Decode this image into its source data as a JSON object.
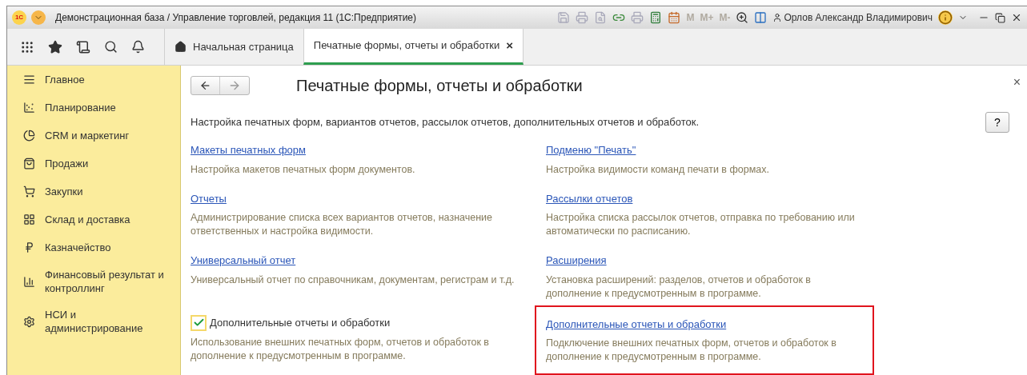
{
  "window": {
    "title": "Демонстрационная база / Управление торговлей, редакция 11  (1С:Предприятие)",
    "logo": "1C",
    "memory_buttons": [
      "M",
      "M+",
      "M-"
    ],
    "user": "Орлов Александр Владимирович"
  },
  "tabs": [
    {
      "label": "Начальная страница",
      "selected": false
    },
    {
      "label": "Печатные формы, отчеты и обработки",
      "selected": true,
      "close": "×"
    }
  ],
  "sidebar": {
    "items": [
      {
        "label": "Главное"
      },
      {
        "label": "Планирование"
      },
      {
        "label": "CRM и маркетинг"
      },
      {
        "label": "Продажи"
      },
      {
        "label": "Закупки"
      },
      {
        "label": "Склад и доставка"
      },
      {
        "label": "Казначейство"
      },
      {
        "label": "Финансовый результат и контроллинг"
      },
      {
        "label": "НСИ и администрирование"
      }
    ]
  },
  "page": {
    "title": "Печатные формы, отчеты и обработки",
    "close": "×",
    "help": "?",
    "description": "Настройка печатных форм, вариантов отчетов, рассылок отчетов, дополнительных отчетов и обработок.",
    "rows": [
      [
        {
          "kind": "link",
          "label": "Макеты печатных форм",
          "text": "Настройка макетов печатных форм документов.",
          "highlighted": false
        },
        {
          "kind": "link",
          "label": "Подменю \"Печать\"",
          "text": "Настройка видимости команд печати в формах.",
          "highlighted": false
        }
      ],
      [
        {
          "kind": "link",
          "label": "Отчеты",
          "text": "Администрирование списка всех вариантов отчетов, назначение ответственных и настройка видимости.",
          "highlighted": false
        },
        {
          "kind": "link",
          "label": "Рассылки отчетов",
          "text": "Настройка списка рассылок отчетов, отправка по требованию или автоматически по расписанию.",
          "highlighted": false
        }
      ],
      [
        {
          "kind": "link",
          "label": "Универсальный отчет",
          "text": "Универсальный отчет по справочникам, документам, регистрам и т.д.",
          "highlighted": false
        },
        {
          "kind": "link",
          "label": "Расширения",
          "text": "Установка расширений: разделов, отчетов и обработок в дополнение к предусмотренным в программе.",
          "highlighted": false
        }
      ],
      [
        {
          "kind": "checkbox",
          "label": "Дополнительные отчеты и обработки",
          "checked": true,
          "text": "Использование внешних печатных форм, отчетов и обработок в дополнение к предусмотренным в программе.",
          "highlighted": false
        },
        {
          "kind": "link",
          "label": "Дополнительные отчеты и обработки",
          "text": "Подключение внешних печатных форм, отчетов и обработок в дополнение к предусмотренным в программе.",
          "highlighted": true
        }
      ]
    ]
  }
}
